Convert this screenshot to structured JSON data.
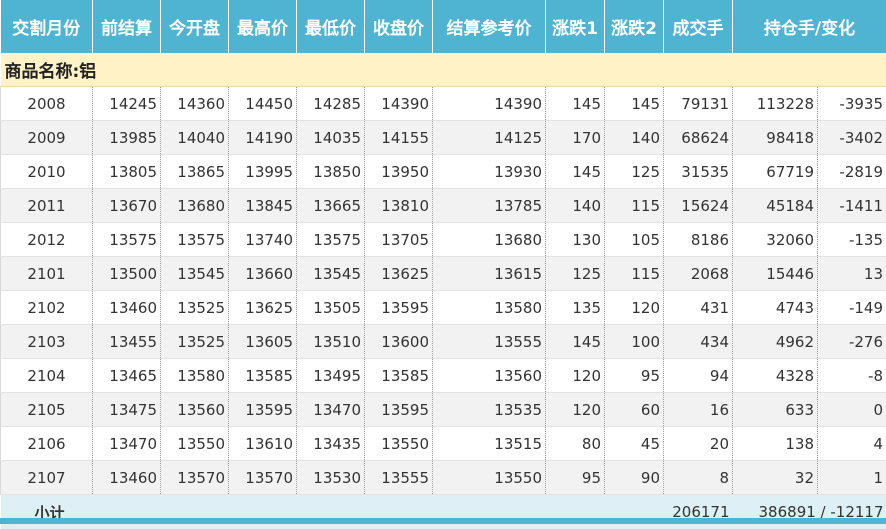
{
  "headers": [
    "交割月份",
    "前结算",
    "今开盘",
    "最高价",
    "最低价",
    "收盘价",
    "结算参考价",
    "涨跌1",
    "涨跌2",
    "成交手",
    "持仓手/变化"
  ],
  "category": "商品名称:铝",
  "rows": [
    [
      "2008",
      "14245",
      "14360",
      "14450",
      "14285",
      "14390",
      "14390",
      "145",
      "145",
      "79131",
      "113228",
      "-3935"
    ],
    [
      "2009",
      "13985",
      "14040",
      "14190",
      "14035",
      "14155",
      "14125",
      "170",
      "140",
      "68624",
      "98418",
      "-3402"
    ],
    [
      "2010",
      "13805",
      "13865",
      "13995",
      "13850",
      "13950",
      "13930",
      "145",
      "125",
      "31535",
      "67719",
      "-2819"
    ],
    [
      "2011",
      "13670",
      "13680",
      "13845",
      "13665",
      "13810",
      "13785",
      "140",
      "115",
      "15624",
      "45184",
      "-1411"
    ],
    [
      "2012",
      "13575",
      "13575",
      "13740",
      "13575",
      "13705",
      "13680",
      "130",
      "105",
      "8186",
      "32060",
      "-135"
    ],
    [
      "2101",
      "13500",
      "13545",
      "13660",
      "13545",
      "13625",
      "13615",
      "125",
      "115",
      "2068",
      "15446",
      "13"
    ],
    [
      "2102",
      "13460",
      "13525",
      "13625",
      "13505",
      "13595",
      "13580",
      "135",
      "120",
      "431",
      "4743",
      "-149"
    ],
    [
      "2103",
      "13455",
      "13525",
      "13605",
      "13510",
      "13600",
      "13555",
      "145",
      "100",
      "434",
      "4962",
      "-276"
    ],
    [
      "2104",
      "13465",
      "13580",
      "13585",
      "13495",
      "13585",
      "13560",
      "120",
      "95",
      "94",
      "4328",
      "-8"
    ],
    [
      "2105",
      "13475",
      "13560",
      "13595",
      "13470",
      "13595",
      "13535",
      "120",
      "60",
      "16",
      "633",
      "0"
    ],
    [
      "2106",
      "13470",
      "13550",
      "13610",
      "13435",
      "13550",
      "13515",
      "80",
      "45",
      "20",
      "138",
      "4"
    ],
    [
      "2107",
      "13460",
      "13570",
      "13570",
      "13530",
      "13555",
      "13550",
      "95",
      "90",
      "8",
      "32",
      "1"
    ]
  ],
  "summary": {
    "label": "小计",
    "volume": "206171",
    "open_interest": "386891 / -12117"
  }
}
